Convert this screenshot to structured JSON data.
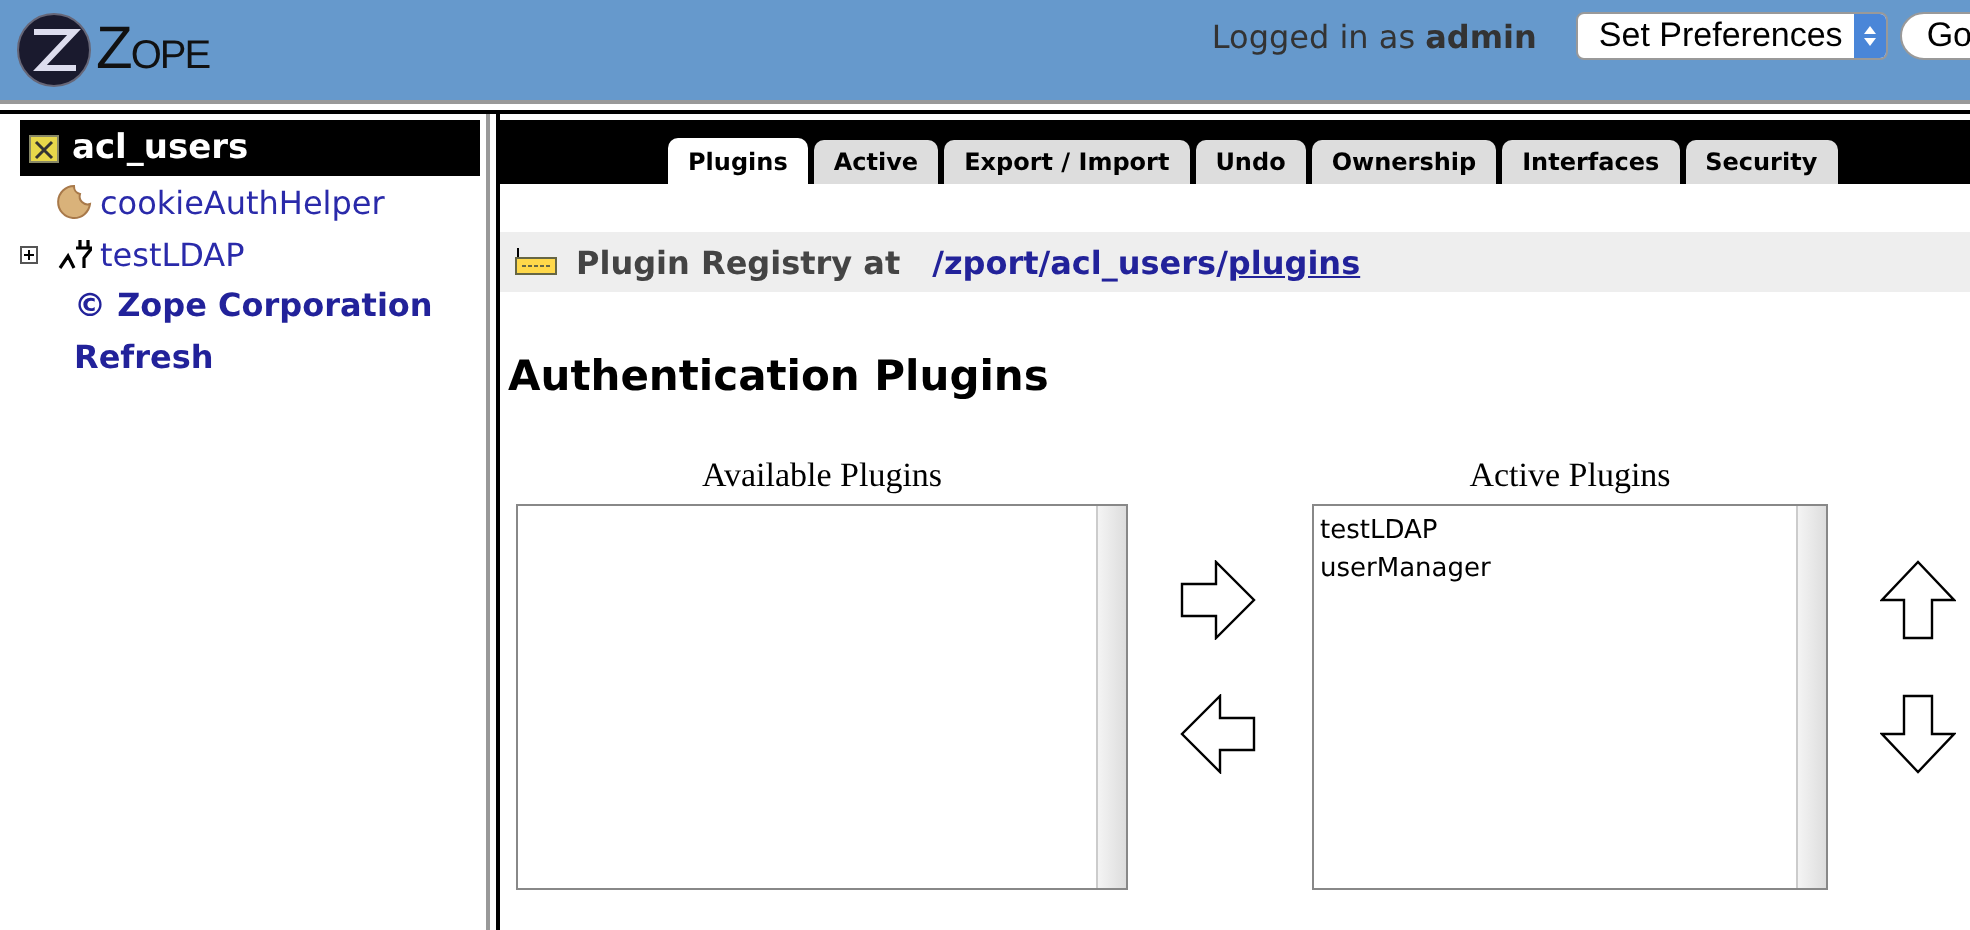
{
  "header": {
    "logo_text": "ZOPE",
    "logged_in": "Logged in as **admin**",
    "preferences_select": "Set Preferences",
    "go_button": "Go"
  },
  "tree": {
    "title": "acl_users",
    "items": [
      {
        "kind": "cookie",
        "label": "cookieAuthHelper"
      },
      {
        "kind": "plug",
        "label": "testLDAP",
        "expanded": false
      }
    ],
    "links": [
      "© Zope Corporation",
      "Refresh"
    ]
  },
  "tabs": [
    {
      "label": "Plugins",
      "selected": true
    },
    {
      "label": "Active",
      "selected": false
    },
    {
      "label": "Export / Import",
      "selected": false
    },
    {
      "label": "Undo",
      "selected": false
    },
    {
      "label": "Ownership",
      "selected": false
    },
    {
      "label": "Interfaces",
      "selected": false
    },
    {
      "label": "Security",
      "selected": false
    }
  ],
  "registry": {
    "label": "Plugin Registry at",
    "path": [
      "/zport",
      "/acl_users",
      "/"
    ],
    "link": "plugins"
  },
  "heading": "Authentication Plugins",
  "available": {
    "title": "Available Plugins"
  },
  "active": {
    "title": "Active Plugins",
    "items": [
      "testLDAP",
      "userManager"
    ]
  }
}
